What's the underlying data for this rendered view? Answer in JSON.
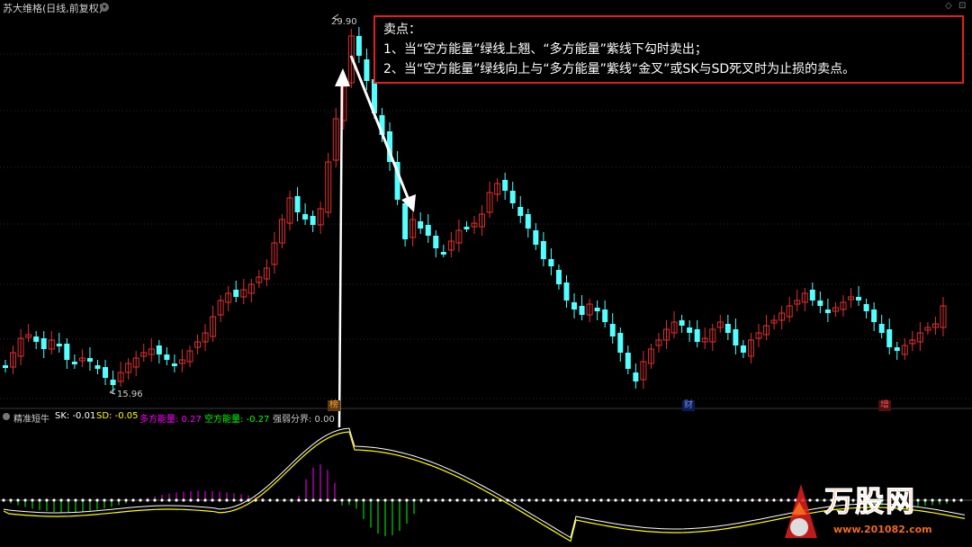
{
  "window": {
    "title": "苏大维格(日线,前复权)",
    "corner_icons": [
      "◇",
      "⊡"
    ]
  },
  "main_chart": {
    "price_high_label": "29.90",
    "price_low_label": "15.96",
    "up_color": "#e03030",
    "down_color": "#54ffff",
    "event_badges": [
      {
        "text": "榜",
        "color": "#ff9933"
      },
      {
        "text": "财",
        "color": "#3366ff"
      },
      {
        "text": "增",
        "color": "#e03030"
      }
    ]
  },
  "annotation": {
    "heading": "卖点：",
    "line1": "1、当“空方能量”绿线上翘、“多方能量”紫线下勾时卖出；",
    "line2": "2、当“空方能量”绿线向上与“多方能量”紫线“金叉”或SK与SD死叉时为止损的卖点。"
  },
  "indicator": {
    "name": "精准短牛",
    "sk_label": "SK: -0.01",
    "sd_label": "SD: -0.05",
    "bull_label": "多方能量: 0.27",
    "bear_label": "空方能量: -0.27",
    "divide_label": "强弱分界: 0.00",
    "sk_color": "#ffffff",
    "sd_color": "#ffff00",
    "bull_color": "#ff00ff",
    "bear_color": "#00ff00"
  },
  "watermark": {
    "text": "万股网",
    "url": "www.201082.com"
  }
}
